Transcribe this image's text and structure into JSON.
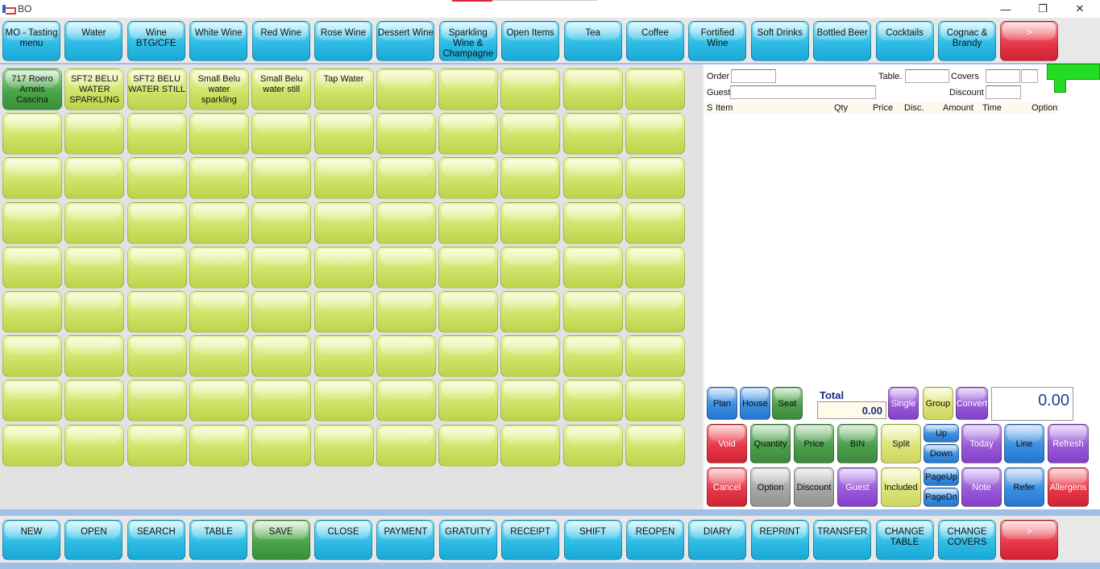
{
  "window": {
    "title": "BO",
    "minimize": "—",
    "restore": "❐",
    "close": "✕"
  },
  "categories": [
    {
      "label": "MO - Tasting menu",
      "color": "cyan"
    },
    {
      "label": "Water",
      "color": "cyan"
    },
    {
      "label": "Wine BTG/CFE",
      "color": "cyan"
    },
    {
      "label": "White Wine",
      "color": "cyan"
    },
    {
      "label": "Red Wine",
      "color": "cyan"
    },
    {
      "label": "Rose Wine",
      "color": "cyan"
    },
    {
      "label": "Dessert Wine",
      "color": "cyan"
    },
    {
      "label": "Sparkling Wine & Champagne",
      "color": "cyan"
    },
    {
      "label": "Open Items",
      "color": "cyan"
    },
    {
      "label": "Tea",
      "color": "cyan"
    },
    {
      "label": "Coffee",
      "color": "cyan"
    },
    {
      "label": "Fortified Wine",
      "color": "cyan"
    },
    {
      "label": "Soft Drinks",
      "color": "cyan"
    },
    {
      "label": "Bottled Beer",
      "color": "cyan"
    },
    {
      "label": "Cocktails",
      "color": "cyan"
    },
    {
      "label": "Cognac & Brandy",
      "color": "cyan"
    },
    {
      "label": ">",
      "color": "red"
    }
  ],
  "items": [
    {
      "label": "717 Roero Arneis Cascina",
      "color": "green"
    },
    {
      "label": "SFT2 BELU WATER SPARKLING",
      "color": "lime"
    },
    {
      "label": "SFT2 BELU WATER STILL",
      "color": "lime"
    },
    {
      "label": "Small Belu water sparkling",
      "color": "lime"
    },
    {
      "label": "Small Belu water still",
      "color": "lime"
    },
    {
      "label": "Tap Water",
      "color": "lime"
    }
  ],
  "order": {
    "order_label": "Order",
    "table_label": "Table.",
    "covers_label": "Covers",
    "guest_label": "Guest",
    "discount_label": "Discount",
    "columns": [
      "S",
      "Item",
      "Qty",
      "Price",
      "Disc.",
      "Amount",
      "Time",
      "Option"
    ]
  },
  "totals": {
    "label": "Total",
    "value": "0.00",
    "big_value": "0.00"
  },
  "action_buttons": [
    {
      "label": "Plan",
      "color": "blue"
    },
    {
      "label": "House",
      "color": "blue"
    },
    {
      "label": "Seat",
      "color": "dgreen"
    },
    {
      "label": "Single",
      "color": "purple"
    },
    {
      "label": "Group",
      "color": "yellowish"
    },
    {
      "label": "Convert",
      "color": "purple"
    },
    {
      "label": "Void",
      "color": "red"
    },
    {
      "label": "Quantity",
      "color": "dgreen"
    },
    {
      "label": "Price",
      "color": "dgreen"
    },
    {
      "label": "BIN",
      "color": "dgreen"
    },
    {
      "label": "Split",
      "color": "yellowish"
    },
    {
      "label": "Up",
      "color": "blue"
    },
    {
      "label": "Down",
      "color": "blue"
    },
    {
      "label": "Today",
      "color": "purple"
    },
    {
      "label": "Line",
      "color": "blue"
    },
    {
      "label": "Refresh",
      "color": "purple"
    },
    {
      "label": "Cancel",
      "color": "red"
    },
    {
      "label": "Option",
      "color": "gray"
    },
    {
      "label": "Discount",
      "color": "gray"
    },
    {
      "label": "Guest",
      "color": "purple"
    },
    {
      "label": "Included",
      "color": "yellowish"
    },
    {
      "label": "PageUp",
      "color": "blue"
    },
    {
      "label": "PageDn",
      "color": "blue"
    },
    {
      "label": "Note",
      "color": "purple"
    },
    {
      "label": "Refer",
      "color": "blue"
    },
    {
      "label": "Allergens",
      "color": "red"
    }
  ],
  "functions": [
    {
      "label": "NEW",
      "color": "cyan"
    },
    {
      "label": "OPEN",
      "color": "cyan"
    },
    {
      "label": "SEARCH",
      "color": "cyan"
    },
    {
      "label": "TABLE",
      "color": "cyan"
    },
    {
      "label": "SAVE",
      "color": "green"
    },
    {
      "label": "CLOSE",
      "color": "cyan"
    },
    {
      "label": "PAYMENT",
      "color": "cyan"
    },
    {
      "label": "GRATUITY",
      "color": "cyan"
    },
    {
      "label": "RECEIPT",
      "color": "cyan"
    },
    {
      "label": "SHIFT",
      "color": "cyan"
    },
    {
      "label": "REOPEN",
      "color": "cyan"
    },
    {
      "label": "DIARY",
      "color": "cyan"
    },
    {
      "label": "REPRINT",
      "color": "cyan"
    },
    {
      "label": "TRANSFER",
      "color": "cyan"
    },
    {
      "label": "CHANGE TABLE",
      "color": "cyan"
    },
    {
      "label": "CHANGE COVERS",
      "color": "cyan"
    },
    {
      "label": ">",
      "color": "red"
    }
  ]
}
